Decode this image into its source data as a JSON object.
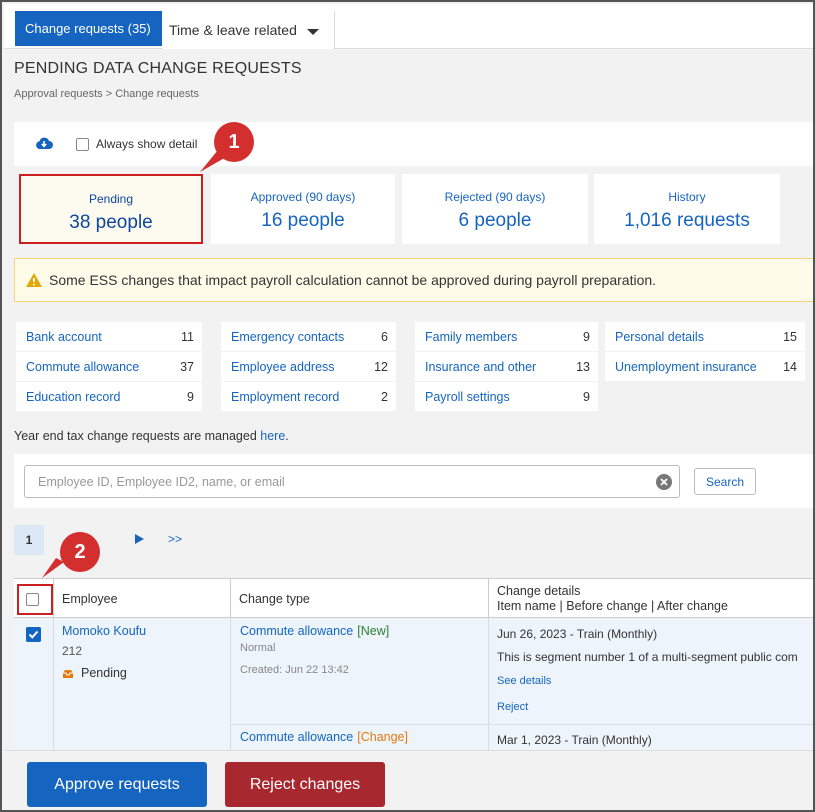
{
  "tabs": [
    {
      "label": "Change requests (35)"
    },
    {
      "label": "Time & leave related"
    }
  ],
  "page": {
    "title": "PENDING DATA CHANGE REQUESTS",
    "breadcrumb": "Approval requests > Change requests"
  },
  "toolbar": {
    "download_icon": "cloud-download-icon",
    "always_show_label": "Always show detail"
  },
  "stats": [
    {
      "label": "Pending",
      "value": "38 people"
    },
    {
      "label": "Approved (90 days)",
      "value": "16 people"
    },
    {
      "label": "Rejected (90 days)",
      "value": "6 people"
    },
    {
      "label": "History",
      "value": "1,016 requests"
    }
  ],
  "warning": {
    "icon": "warning-icon",
    "text": "Some ESS changes that impact payroll calculation cannot be approved during payroll preparation."
  },
  "categories": [
    {
      "name": "Bank account",
      "count": "11"
    },
    {
      "name": "Commute allowance",
      "count": "37"
    },
    {
      "name": "Education record",
      "count": "9"
    },
    {
      "name": "Emergency contacts",
      "count": "6"
    },
    {
      "name": "Employee address",
      "count": "12"
    },
    {
      "name": "Employment record",
      "count": "2"
    },
    {
      "name": "Family members",
      "count": "9"
    },
    {
      "name": "Insurance and other",
      "count": "13"
    },
    {
      "name": "Payroll settings",
      "count": "9"
    },
    {
      "name": "Personal details",
      "count": "15"
    },
    {
      "name": "Unemployment insurance",
      "count": "14"
    }
  ],
  "year_end": {
    "text": "Year end tax change requests are managed ",
    "link": "here",
    "suffix": "."
  },
  "search": {
    "placeholder": "Employee ID, Employee ID2, name, or email",
    "button": "Search"
  },
  "pager": {
    "current": "1",
    "last": ">>"
  },
  "callouts": [
    "1",
    "2"
  ],
  "table": {
    "headers": {
      "employee": "Employee",
      "change_type": "Change type",
      "change_details": "Change details",
      "change_details_sub": "Item name | Before change | After change"
    },
    "row": {
      "name": "Momoko Koufu",
      "id": "212",
      "status": "Pending",
      "changes": [
        {
          "type": "Commute allowance",
          "tag": "[New]",
          "sub": "Normal",
          "created": "Created: Jun 22 13:42",
          "date": "Jun 26, 2023 - Train (Monthly)",
          "text": "This is segment number 1 of a multi-segment public com",
          "see_details": "See details",
          "reject": "Reject"
        },
        {
          "type": "Commute allowance",
          "tag": "[Change]",
          "date": "Mar 1, 2023 - Train (Monthly)"
        }
      ]
    }
  },
  "footer": {
    "approve": "Approve requests",
    "reject": "Reject changes"
  },
  "colors": {
    "accent": "#1565c0",
    "reject": "#a8282f",
    "callout": "#d32f2f",
    "new_tag": "#2e7d32",
    "change_tag": "#e07b10"
  }
}
